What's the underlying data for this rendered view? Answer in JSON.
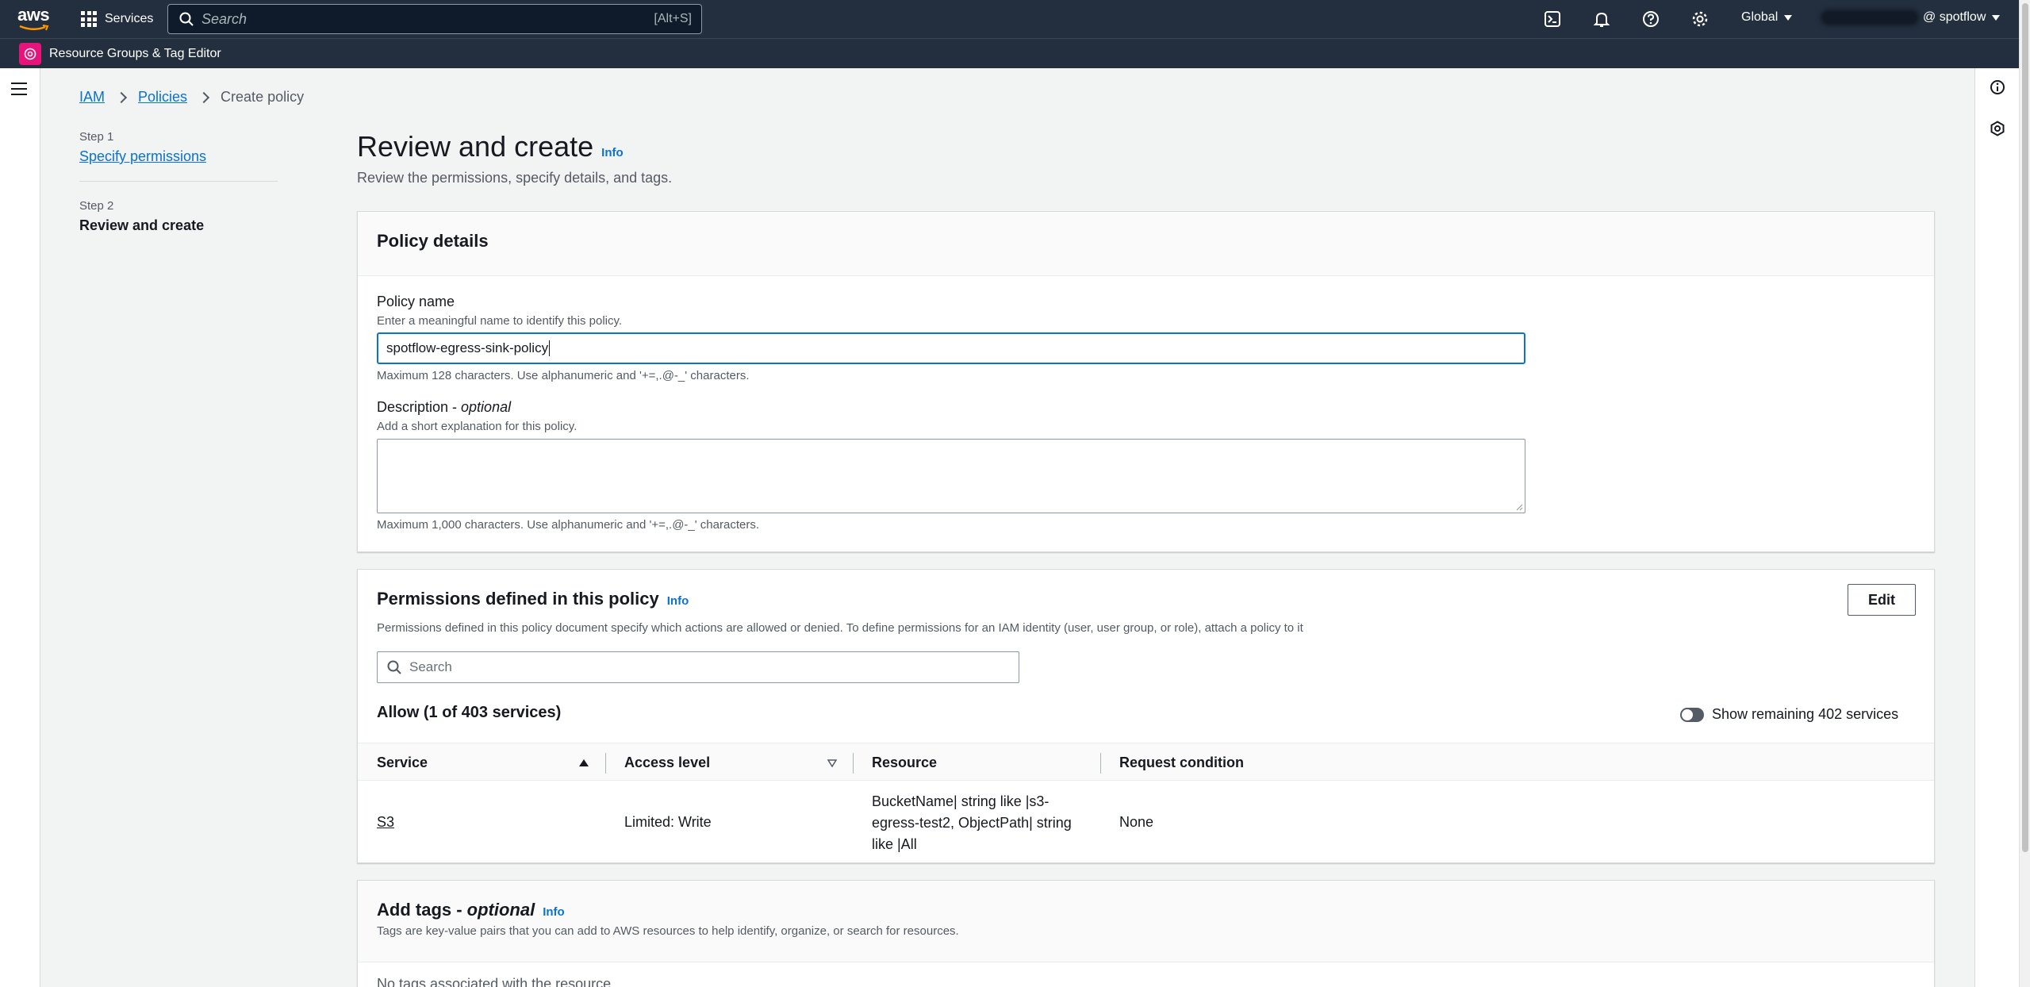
{
  "topnav": {
    "logo_text": "aws",
    "services_label": "Services",
    "search_placeholder": "Search",
    "search_shortcut": "[Alt+S]",
    "region_label": "Global",
    "account_suffix": "@ spotflow"
  },
  "subbar": {
    "service_name": "Resource Groups & Tag Editor"
  },
  "breadcrumb": {
    "items": [
      "IAM",
      "Policies",
      "Create policy"
    ]
  },
  "steps": [
    {
      "number": "Step 1",
      "label": "Specify permissions"
    },
    {
      "number": "Step 2",
      "label": "Review and create"
    }
  ],
  "header": {
    "title": "Review and create",
    "info": "Info",
    "subtitle": "Review the permissions, specify details, and tags."
  },
  "policy_details": {
    "title": "Policy details",
    "name_label": "Policy name",
    "name_hint": "Enter a meaningful name to identify this policy.",
    "name_value": "spotflow-egress-sink-policy",
    "name_constraint": "Maximum 128 characters. Use alphanumeric and '+=,.@-_' characters.",
    "desc_label": "Description - ",
    "desc_optional": "optional",
    "desc_hint": "Add a short explanation for this policy.",
    "desc_value": "",
    "desc_constraint": "Maximum 1,000 characters. Use alphanumeric and '+=,.@-_' characters."
  },
  "permissions": {
    "title": "Permissions defined in this policy",
    "info": "Info",
    "edit_label": "Edit",
    "description": "Permissions defined in this policy document specify which actions are allowed or denied. To define permissions for an IAM identity (user, user group, or role), attach a policy to it",
    "search_placeholder": "Search",
    "allow_heading": "Allow (1 of 403 services)",
    "toggle_label": "Show remaining 402 services",
    "columns": [
      "Service",
      "Access level",
      "Resource",
      "Request condition"
    ],
    "rows": [
      {
        "service": "S3",
        "access_level": "Limited: Write",
        "resource": "BucketName| string like |s3-egress-test2, ObjectPath| string like |All",
        "request_condition": "None"
      }
    ]
  },
  "tags": {
    "title": "Add tags - ",
    "title_optional": "optional",
    "info": "Info",
    "description": "Tags are key-value pairs that you can add to AWS resources to help identify, organize, or search for resources.",
    "empty_text": "No tags associated with the resource."
  },
  "colors": {
    "nav_bg": "#232f3e",
    "link": "#0972d3",
    "rg_badge": "#e7157b"
  }
}
